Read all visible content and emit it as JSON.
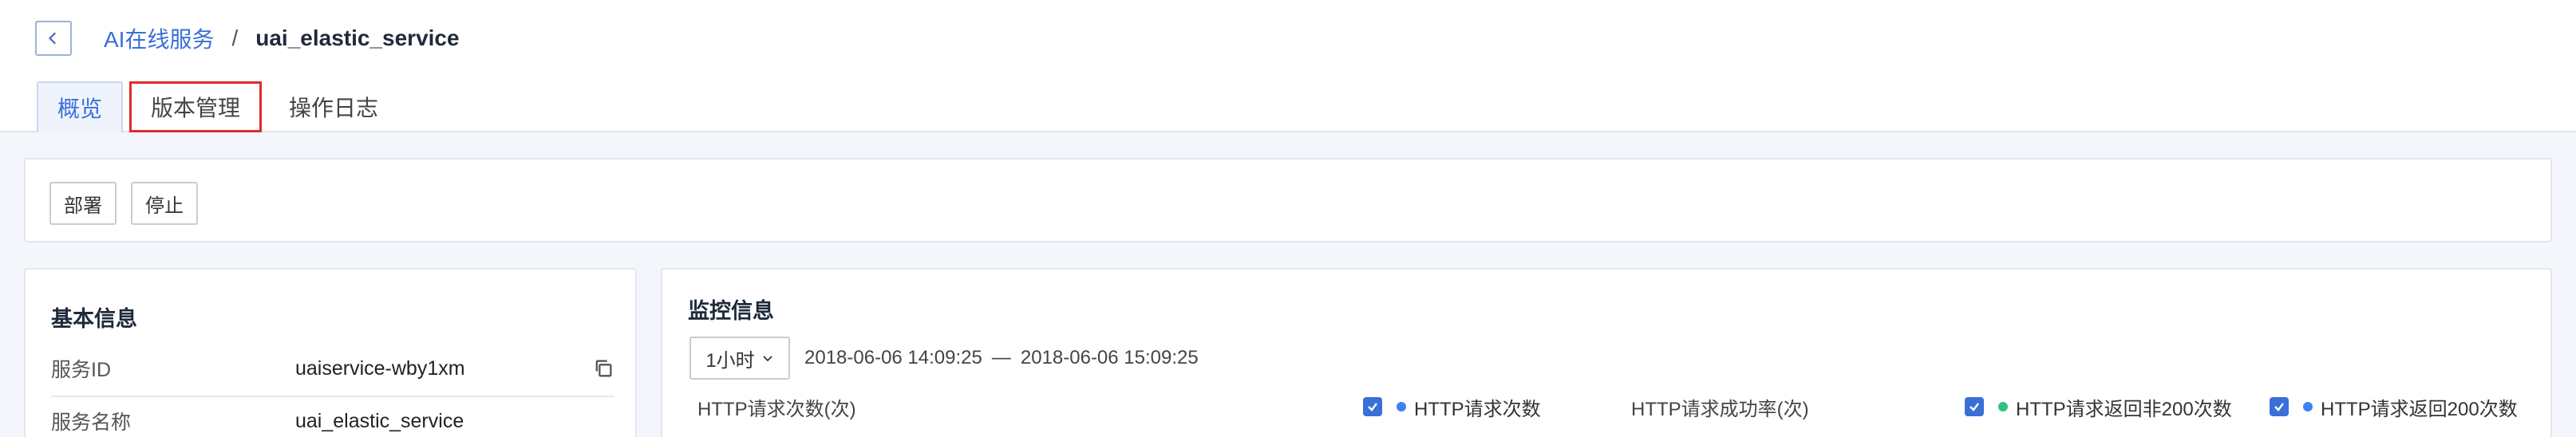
{
  "header": {
    "breadcrumb": {
      "parent": "AI在线服务",
      "separator": "/",
      "current": "uai_elastic_service"
    }
  },
  "tabs": [
    {
      "label": "概览",
      "active": true
    },
    {
      "label": "版本管理",
      "highlighted": true
    },
    {
      "label": "操作日志"
    }
  ],
  "actions": {
    "deploy_label": "部署",
    "stop_label": "停止"
  },
  "basic_info": {
    "title": "基本信息",
    "rows": [
      {
        "key": "服务ID",
        "value": "uaiservice-wby1xm"
      },
      {
        "key": "服务名称",
        "value": "uai_elastic_service"
      }
    ]
  },
  "monitor": {
    "title": "监控信息",
    "range_select": "1小时",
    "time_start": "2018-06-06 14:09:25",
    "time_separator": "—",
    "time_end": "2018-06-06 15:09:25",
    "charts": [
      {
        "label": "HTTP请求次数(次)",
        "legend": [
          {
            "name": "HTTP请求次数",
            "color": "#3b82f6",
            "checked": true
          }
        ]
      },
      {
        "label": "HTTP请求成功率(次)",
        "legend": [
          {
            "name": "HTTP请求返回非200次数",
            "color": "#2ec27e",
            "checked": true
          },
          {
            "name": "HTTP请求返回200次数",
            "color": "#3b82f6",
            "checked": true
          }
        ]
      }
    ]
  },
  "colors": {
    "accent": "#3b6fd8",
    "highlight_border": "#e02b2b",
    "page_bg": "#f4f6fb"
  },
  "icons": {
    "back": "chevron-left-icon",
    "copy": "copy-icon",
    "dropdown": "chevron-down-icon",
    "checkbox": "check-icon"
  }
}
